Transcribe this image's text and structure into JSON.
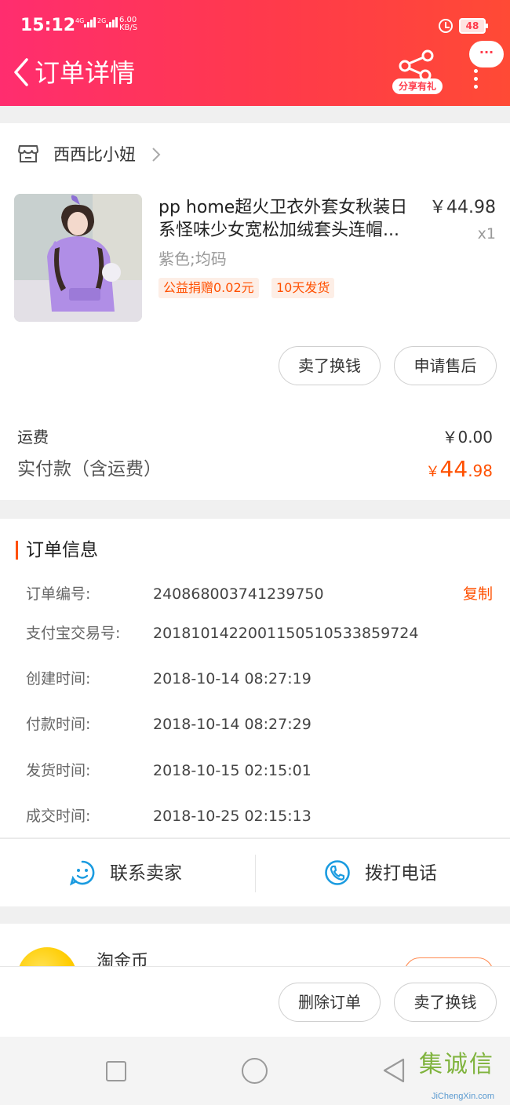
{
  "status_bar": {
    "time": "15:12",
    "net_4g": "4G",
    "net_2g": "2G",
    "speed_value": "6.00",
    "speed_unit": "KB/S",
    "battery": "48"
  },
  "header": {
    "title": "订单详情",
    "share_label": "分享有礼",
    "more_bubble": "···"
  },
  "shop": {
    "name": "西西比小妞"
  },
  "product": {
    "title": "pp home超火卫衣外套女秋装日系怪味少女宽松加绒套头连帽...",
    "price": "￥44.98",
    "qty": "x1",
    "sku": "紫色;均码",
    "tags": [
      "公益捐赠0.02元",
      "10天发货"
    ]
  },
  "item_actions": {
    "sell": "卖了换钱",
    "after_sale": "申请售后"
  },
  "fees": {
    "shipping_label": "运费",
    "shipping_value": "￥0.00",
    "total_label": "实付款（含运费）",
    "total_currency": "￥",
    "total_int": "44",
    "total_dec": ".98"
  },
  "order_info": {
    "title": "订单信息",
    "copy_label": "复制",
    "rows": [
      {
        "key": "订单编号:",
        "value": "240868003741239750"
      },
      {
        "key": "支付宝交易号:",
        "value": "2018101422001150510533859724"
      },
      {
        "key": "创建时间:",
        "value": "2018-10-14 08:27:19"
      },
      {
        "key": "付款时间:",
        "value": "2018-10-14 08:27:29"
      },
      {
        "key": "发货时间:",
        "value": "2018-10-15 02:15:01"
      },
      {
        "key": "成交时间:",
        "value": "2018-10-25 02:15:13"
      }
    ]
  },
  "contact": {
    "seller": "联系卖家",
    "call": "拨打电话"
  },
  "coins": {
    "title": "淘金币"
  },
  "bottom_actions": {
    "delete": "删除订单",
    "sell": "卖了换钱"
  },
  "watermark": {
    "text": "集诚信",
    "sub": "JiChengXin.com"
  },
  "colors": {
    "accent": "#ff5000",
    "header_start": "#ff2d6f",
    "header_end": "#ff4a35",
    "icon_blue": "#1a9be0"
  }
}
